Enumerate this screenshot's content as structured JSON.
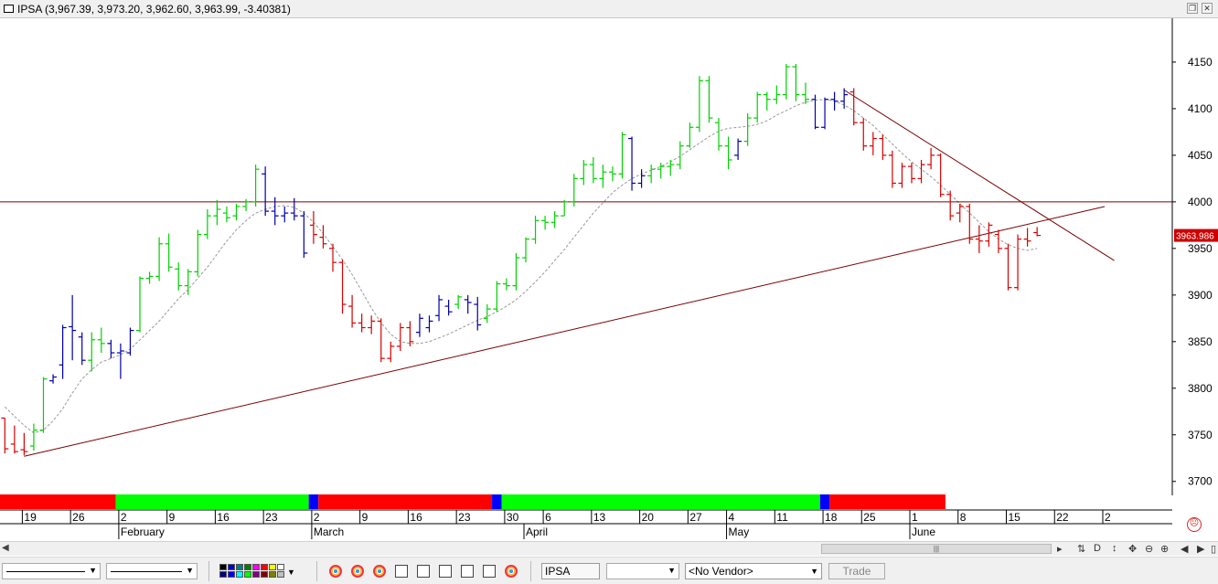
{
  "window": {
    "symbol": "IPSA",
    "title": "IPSA (3,967.39, 3,973.20, 3,962.60, 3,963.99, -3.40381)"
  },
  "chart_data": {
    "type": "ohlc",
    "y_ticks": [
      4150,
      4100,
      4050,
      4000,
      3950,
      3900,
      3850,
      3800,
      3750,
      3700
    ],
    "ylim": [
      3687,
      4197
    ],
    "last_price_label": "3963.986",
    "day_ticks": [
      {
        "label": "19",
        "slot": 2
      },
      {
        "label": "26",
        "slot": 7
      },
      {
        "label": "2",
        "slot": 12
      },
      {
        "label": "9",
        "slot": 17
      },
      {
        "label": "16",
        "slot": 22
      },
      {
        "label": "23",
        "slot": 27
      },
      {
        "label": "2",
        "slot": 32
      },
      {
        "label": "9",
        "slot": 37
      },
      {
        "label": "16",
        "slot": 42
      },
      {
        "label": "23",
        "slot": 47
      },
      {
        "label": "30",
        "slot": 52
      },
      {
        "label": "6",
        "slot": 56
      },
      {
        "label": "13",
        "slot": 61
      },
      {
        "label": "20",
        "slot": 66
      },
      {
        "label": "27",
        "slot": 71
      },
      {
        "label": "4",
        "slot": 75
      },
      {
        "label": "11",
        "slot": 80
      },
      {
        "label": "18",
        "slot": 85
      },
      {
        "label": "25",
        "slot": 89
      },
      {
        "label": "1",
        "slot": 94
      },
      {
        "label": "8",
        "slot": 99
      },
      {
        "label": "15",
        "slot": 104
      },
      {
        "label": "22",
        "slot": 109
      },
      {
        "label": "2",
        "slot": 114
      }
    ],
    "month_ticks": [
      {
        "label": "February",
        "slot": 12
      },
      {
        "label": "March",
        "slot": 32
      },
      {
        "label": "April",
        "slot": 54
      },
      {
        "label": "May",
        "slot": 75
      },
      {
        "label": "June",
        "slot": 94
      }
    ],
    "bars": [
      {
        "o": 3768,
        "h": 3768,
        "l": 3730,
        "c": 3735,
        "color": "red"
      },
      {
        "o": 3740,
        "h": 3760,
        "l": 3730,
        "c": 3732,
        "color": "red"
      },
      {
        "o": 3734,
        "h": 3752,
        "l": 3728,
        "c": 3732,
        "color": "red"
      },
      {
        "o": 3738,
        "h": 3762,
        "l": 3733,
        "c": 3755,
        "color": "green"
      },
      {
        "o": 3755,
        "h": 3812,
        "l": 3752,
        "c": 3810,
        "color": "green"
      },
      {
        "o": 3808,
        "h": 3815,
        "l": 3805,
        "c": 3812,
        "color": "blue"
      },
      {
        "o": 3825,
        "h": 3868,
        "l": 3810,
        "c": 3865,
        "color": "blue"
      },
      {
        "o": 3866,
        "h": 3900,
        "l": 3830,
        "c": 3862,
        "color": "blue"
      },
      {
        "o": 3855,
        "h": 3860,
        "l": 3825,
        "c": 3830,
        "color": "blue"
      },
      {
        "o": 3830,
        "h": 3860,
        "l": 3818,
        "c": 3852,
        "color": "green"
      },
      {
        "o": 3852,
        "h": 3865,
        "l": 3838,
        "c": 3848,
        "color": "green"
      },
      {
        "o": 3848,
        "h": 3852,
        "l": 3832,
        "c": 3838,
        "color": "blue"
      },
      {
        "o": 3838,
        "h": 3848,
        "l": 3810,
        "c": 3840,
        "color": "blue"
      },
      {
        "o": 3838,
        "h": 3865,
        "l": 3835,
        "c": 3862,
        "color": "blue"
      },
      {
        "o": 3862,
        "h": 3920,
        "l": 3860,
        "c": 3918,
        "color": "green"
      },
      {
        "o": 3918,
        "h": 3925,
        "l": 3912,
        "c": 3920,
        "color": "green"
      },
      {
        "o": 3920,
        "h": 3962,
        "l": 3915,
        "c": 3955,
        "color": "green"
      },
      {
        "o": 3955,
        "h": 3966,
        "l": 3925,
        "c": 3930,
        "color": "green"
      },
      {
        "o": 3928,
        "h": 3935,
        "l": 3905,
        "c": 3910,
        "color": "green"
      },
      {
        "o": 3910,
        "h": 3928,
        "l": 3900,
        "c": 3925,
        "color": "green"
      },
      {
        "o": 3925,
        "h": 3970,
        "l": 3920,
        "c": 3965,
        "color": "green"
      },
      {
        "o": 3965,
        "h": 3992,
        "l": 3960,
        "c": 3985,
        "color": "green"
      },
      {
        "o": 3985,
        "h": 4002,
        "l": 3975,
        "c": 3992,
        "color": "green"
      },
      {
        "o": 3988,
        "h": 3995,
        "l": 3978,
        "c": 3983,
        "color": "green"
      },
      {
        "o": 3985,
        "h": 3998,
        "l": 3980,
        "c": 3995,
        "color": "green"
      },
      {
        "o": 3995,
        "h": 4003,
        "l": 3990,
        "c": 4000,
        "color": "green"
      },
      {
        "o": 4000,
        "h": 4040,
        "l": 3995,
        "c": 4035,
        "color": "green"
      },
      {
        "o": 4030,
        "h": 4038,
        "l": 3985,
        "c": 3990,
        "color": "blue"
      },
      {
        "o": 3990,
        "h": 4005,
        "l": 3975,
        "c": 3985,
        "color": "blue"
      },
      {
        "o": 3985,
        "h": 3995,
        "l": 3978,
        "c": 3988,
        "color": "blue"
      },
      {
        "o": 3988,
        "h": 4004,
        "l": 3980,
        "c": 3985,
        "color": "blue"
      },
      {
        "o": 3985,
        "h": 3990,
        "l": 3940,
        "c": 3945,
        "color": "blue"
      },
      {
        "o": 3975,
        "h": 3990,
        "l": 3955,
        "c": 3965,
        "color": "red"
      },
      {
        "o": 3962,
        "h": 3975,
        "l": 3950,
        "c": 3955,
        "color": "red"
      },
      {
        "o": 3950,
        "h": 3955,
        "l": 3925,
        "c": 3935,
        "color": "red"
      },
      {
        "o": 3935,
        "h": 3938,
        "l": 3880,
        "c": 3890,
        "color": "red"
      },
      {
        "o": 3888,
        "h": 3900,
        "l": 3865,
        "c": 3870,
        "color": "red"
      },
      {
        "o": 3870,
        "h": 3880,
        "l": 3860,
        "c": 3865,
        "color": "red"
      },
      {
        "o": 3865,
        "h": 3878,
        "l": 3858,
        "c": 3872,
        "color": "red"
      },
      {
        "o": 3872,
        "h": 3875,
        "l": 3828,
        "c": 3832,
        "color": "red"
      },
      {
        "o": 3832,
        "h": 3850,
        "l": 3828,
        "c": 3845,
        "color": "red"
      },
      {
        "o": 3845,
        "h": 3870,
        "l": 3840,
        "c": 3865,
        "color": "red"
      },
      {
        "o": 3865,
        "h": 3872,
        "l": 3845,
        "c": 3850,
        "color": "red"
      },
      {
        "o": 3860,
        "h": 3880,
        "l": 3855,
        "c": 3875,
        "color": "blue"
      },
      {
        "o": 3865,
        "h": 3878,
        "l": 3860,
        "c": 3872,
        "color": "blue"
      },
      {
        "o": 3878,
        "h": 3900,
        "l": 3872,
        "c": 3895,
        "color": "blue"
      },
      {
        "o": 3888,
        "h": 3895,
        "l": 3878,
        "c": 3882,
        "color": "blue"
      },
      {
        "o": 3890,
        "h": 3900,
        "l": 3885,
        "c": 3898,
        "color": "green"
      },
      {
        "o": 3895,
        "h": 3900,
        "l": 3880,
        "c": 3892,
        "color": "blue"
      },
      {
        "o": 3890,
        "h": 3898,
        "l": 3862,
        "c": 3868,
        "color": "blue"
      },
      {
        "o": 3875,
        "h": 3890,
        "l": 3870,
        "c": 3885,
        "color": "green"
      },
      {
        "o": 3885,
        "h": 3915,
        "l": 3882,
        "c": 3912,
        "color": "green"
      },
      {
        "o": 3912,
        "h": 3918,
        "l": 3905,
        "c": 3910,
        "color": "green"
      },
      {
        "o": 3910,
        "h": 3945,
        "l": 3905,
        "c": 3940,
        "color": "green"
      },
      {
        "o": 3940,
        "h": 3962,
        "l": 3935,
        "c": 3960,
        "color": "green"
      },
      {
        "o": 3960,
        "h": 3985,
        "l": 3955,
        "c": 3980,
        "color": "green"
      },
      {
        "o": 3980,
        "h": 3985,
        "l": 3970,
        "c": 3978,
        "color": "green"
      },
      {
        "o": 3978,
        "h": 3990,
        "l": 3972,
        "c": 3985,
        "color": "green"
      },
      {
        "o": 3985,
        "h": 4002,
        "l": 3985,
        "c": 4000,
        "color": "green"
      },
      {
        "o": 4000,
        "h": 4030,
        "l": 3995,
        "c": 4025,
        "color": "green"
      },
      {
        "o": 4025,
        "h": 4045,
        "l": 4018,
        "c": 4040,
        "color": "green"
      },
      {
        "o": 4040,
        "h": 4048,
        "l": 4020,
        "c": 4025,
        "color": "green"
      },
      {
        "o": 4025,
        "h": 4040,
        "l": 4015,
        "c": 4032,
        "color": "green"
      },
      {
        "o": 4032,
        "h": 4038,
        "l": 4022,
        "c": 4030,
        "color": "green"
      },
      {
        "o": 4030,
        "h": 4075,
        "l": 4025,
        "c": 4072,
        "color": "green"
      },
      {
        "o": 4068,
        "h": 4070,
        "l": 4012,
        "c": 4020,
        "color": "blue"
      },
      {
        "o": 4020,
        "h": 4035,
        "l": 4015,
        "c": 4028,
        "color": "blue"
      },
      {
        "o": 4028,
        "h": 4040,
        "l": 4020,
        "c": 4035,
        "color": "green"
      },
      {
        "o": 4035,
        "h": 4042,
        "l": 4025,
        "c": 4038,
        "color": "green"
      },
      {
        "o": 4038,
        "h": 4045,
        "l": 4028,
        "c": 4040,
        "color": "green"
      },
      {
        "o": 4040,
        "h": 4065,
        "l": 4035,
        "c": 4060,
        "color": "green"
      },
      {
        "o": 4060,
        "h": 4085,
        "l": 4058,
        "c": 4080,
        "color": "green"
      },
      {
        "o": 4080,
        "h": 4135,
        "l": 4075,
        "c": 4130,
        "color": "green"
      },
      {
        "o": 4130,
        "h": 4135,
        "l": 4085,
        "c": 4090,
        "color": "green"
      },
      {
        "o": 4085,
        "h": 4090,
        "l": 4055,
        "c": 4060,
        "color": "green"
      },
      {
        "o": 4060,
        "h": 4070,
        "l": 4035,
        "c": 4045,
        "color": "green"
      },
      {
        "o": 4050,
        "h": 4068,
        "l": 4045,
        "c": 4065,
        "color": "blue"
      },
      {
        "o": 4065,
        "h": 4095,
        "l": 4060,
        "c": 4090,
        "color": "green"
      },
      {
        "o": 4090,
        "h": 4118,
        "l": 4085,
        "c": 4115,
        "color": "green"
      },
      {
        "o": 4115,
        "h": 4118,
        "l": 4098,
        "c": 4110,
        "color": "green"
      },
      {
        "o": 4110,
        "h": 4125,
        "l": 4105,
        "c": 4115,
        "color": "green"
      },
      {
        "o": 4115,
        "h": 4148,
        "l": 4110,
        "c": 4145,
        "color": "green"
      },
      {
        "o": 4145,
        "h": 4148,
        "l": 4108,
        "c": 4115,
        "color": "green"
      },
      {
        "o": 4115,
        "h": 4128,
        "l": 4105,
        "c": 4110,
        "color": "green"
      },
      {
        "o": 4110,
        "h": 4115,
        "l": 4078,
        "c": 4080,
        "color": "blue"
      },
      {
        "o": 4080,
        "h": 4112,
        "l": 4078,
        "c": 4110,
        "color": "blue"
      },
      {
        "o": 4110,
        "h": 4118,
        "l": 4098,
        "c": 4108,
        "color": "blue"
      },
      {
        "o": 4108,
        "h": 4122,
        "l": 4100,
        "c": 4115,
        "color": "blue"
      },
      {
        "o": 4118,
        "h": 4122,
        "l": 4082,
        "c": 4085,
        "color": "red"
      },
      {
        "o": 4085,
        "h": 4090,
        "l": 4055,
        "c": 4060,
        "color": "red"
      },
      {
        "o": 4060,
        "h": 4075,
        "l": 4050,
        "c": 4068,
        "color": "red"
      },
      {
        "o": 4068,
        "h": 4072,
        "l": 4045,
        "c": 4050,
        "color": "red"
      },
      {
        "o": 4050,
        "h": 4055,
        "l": 4015,
        "c": 4020,
        "color": "red"
      },
      {
        "o": 4020,
        "h": 4042,
        "l": 4015,
        "c": 4038,
        "color": "red"
      },
      {
        "o": 4038,
        "h": 4042,
        "l": 4020,
        "c": 4025,
        "color": "red"
      },
      {
        "o": 4025,
        "h": 4045,
        "l": 4020,
        "c": 4040,
        "color": "red"
      },
      {
        "o": 4040,
        "h": 4058,
        "l": 4035,
        "c": 4050,
        "color": "red"
      },
      {
        "o": 4050,
        "h": 4052,
        "l": 4005,
        "c": 4008,
        "color": "red"
      },
      {
        "o": 4008,
        "h": 4012,
        "l": 3980,
        "c": 3985,
        "color": "red"
      },
      {
        "o": 3988,
        "h": 3998,
        "l": 3978,
        "c": 3995,
        "color": "red"
      },
      {
        "o": 3995,
        "h": 3998,
        "l": 3955,
        "c": 3960,
        "color": "red"
      },
      {
        "o": 3960,
        "h": 3975,
        "l": 3945,
        "c": 3958,
        "color": "red"
      },
      {
        "o": 3958,
        "h": 3978,
        "l": 3952,
        "c": 3975,
        "color": "red"
      },
      {
        "o": 3965,
        "h": 3970,
        "l": 3945,
        "c": 3950,
        "color": "red"
      },
      {
        "o": 3950,
        "h": 3955,
        "l": 3905,
        "c": 3908,
        "color": "red"
      },
      {
        "o": 3908,
        "h": 3965,
        "l": 3905,
        "c": 3960,
        "color": "red"
      },
      {
        "o": 3960,
        "h": 3972,
        "l": 3952,
        "c": 3958,
        "color": "red"
      },
      {
        "o": 3967,
        "h": 3973,
        "l": 3963,
        "c": 3964,
        "color": "red"
      }
    ],
    "moving_average": [
      3780,
      3770,
      3760,
      3752,
      3755,
      3765,
      3778,
      3795,
      3810,
      3820,
      3828,
      3832,
      3836,
      3842,
      3852,
      3862,
      3872,
      3884,
      3896,
      3906,
      3918,
      3930,
      3944,
      3958,
      3970,
      3980,
      3988,
      3992,
      3995,
      3996,
      3994,
      3988,
      3978,
      3966,
      3952,
      3938,
      3922,
      3904,
      3886,
      3870,
      3858,
      3850,
      3848,
      3848,
      3850,
      3854,
      3858,
      3863,
      3868,
      3873,
      3877,
      3882,
      3888,
      3895,
      3904,
      3914,
      3925,
      3937,
      3949,
      3962,
      3975,
      3988,
      3999,
      4010,
      4018,
      4025,
      4030,
      4034,
      4038,
      4043,
      4049,
      4056,
      4063,
      4070,
      4076,
      4079,
      4080,
      4081,
      4083,
      4087,
      4093,
      4098,
      4103,
      4107,
      4109,
      4110,
      4108,
      4104,
      4098,
      4090,
      4082,
      4072,
      4062,
      4052,
      4043,
      4035,
      4027,
      4018,
      4008,
      3998,
      3988,
      3978,
      3968,
      3960,
      3954,
      3950,
      3948,
      3950
    ],
    "horizontal_line": 4000,
    "trendlines": [
      {
        "from": {
          "slot": 2,
          "value": 3727
        },
        "to": {
          "slot": 114,
          "value": 3995
        }
      },
      {
        "from": {
          "slot": 87,
          "value": 4120
        },
        "to": {
          "slot": 115,
          "value": 3937
        }
      }
    ],
    "trend_bands": [
      {
        "from": 0,
        "to": 11,
        "color": "red"
      },
      {
        "from": 12,
        "to": 31,
        "color": "green"
      },
      {
        "from": 32,
        "to": 32,
        "color": "blue"
      },
      {
        "from": 33,
        "to": 50,
        "color": "red"
      },
      {
        "from": 51,
        "to": 51,
        "color": "blue"
      },
      {
        "from": 52,
        "to": 84,
        "color": "green"
      },
      {
        "from": 85,
        "to": 85,
        "color": "blue"
      },
      {
        "from": 86,
        "to": 97,
        "color": "red"
      }
    ]
  },
  "colors": {
    "up": "#00d000",
    "down": "#d60000",
    "neutral": "#0000a8",
    "line": "#7a0000",
    "band_red": "#ff0000",
    "band_green": "#00ff00",
    "band_blue": "#0000ff"
  },
  "scrollbar": {
    "thumb_grip": "|||"
  },
  "toolbar": {
    "symbol_field": "IPSA",
    "vendor_select": "<No Vendor>",
    "trade_label": "Trade"
  }
}
